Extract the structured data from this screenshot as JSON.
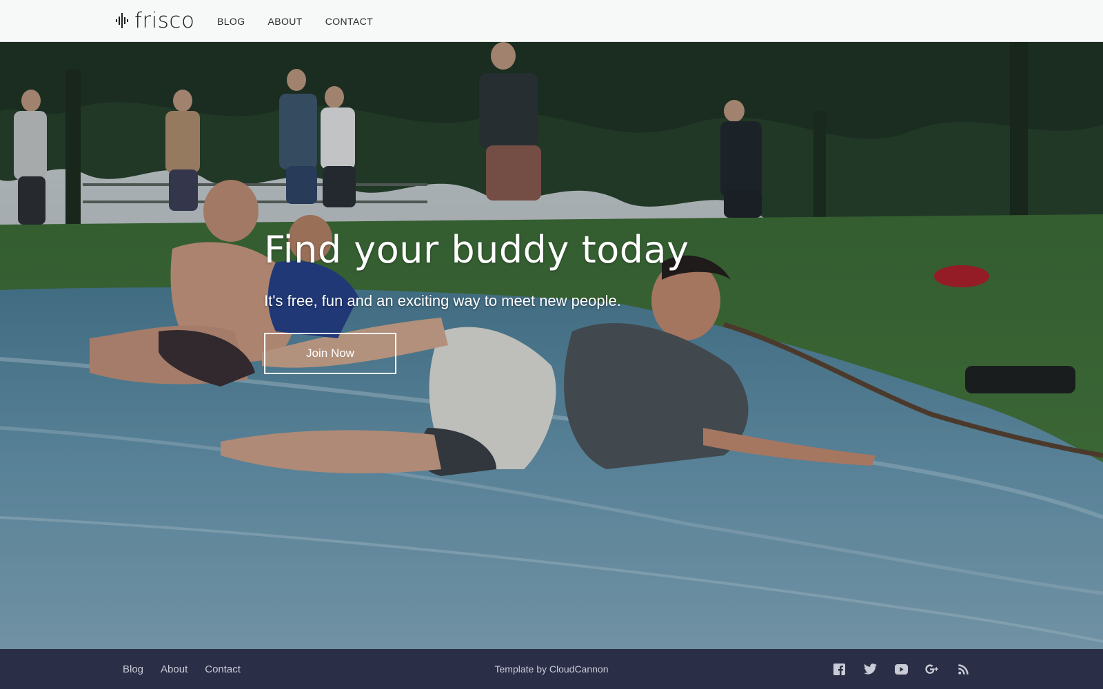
{
  "header": {
    "logo_text": "frisco",
    "nav": [
      {
        "label": "BLOG"
      },
      {
        "label": "ABOUT"
      },
      {
        "label": "CONTACT"
      }
    ]
  },
  "hero": {
    "title": "Find your buddy today",
    "subtitle": "It's free, fun and an exciting way to meet new people.",
    "cta_label": "Join Now",
    "photo_description_icon": "photo-people-on-water-slide"
  },
  "footer": {
    "nav": [
      {
        "label": "Blog"
      },
      {
        "label": "About"
      },
      {
        "label": "Contact"
      }
    ],
    "credit": "Template by CloudCannon",
    "social_icons": [
      "facebook-icon",
      "twitter-icon",
      "youtube-icon",
      "google-plus-icon",
      "rss-icon"
    ]
  },
  "colors": {
    "footer_bg": "#2b2e47",
    "header_bg": "#f7f8f8",
    "text_light": "#ffffff"
  }
}
